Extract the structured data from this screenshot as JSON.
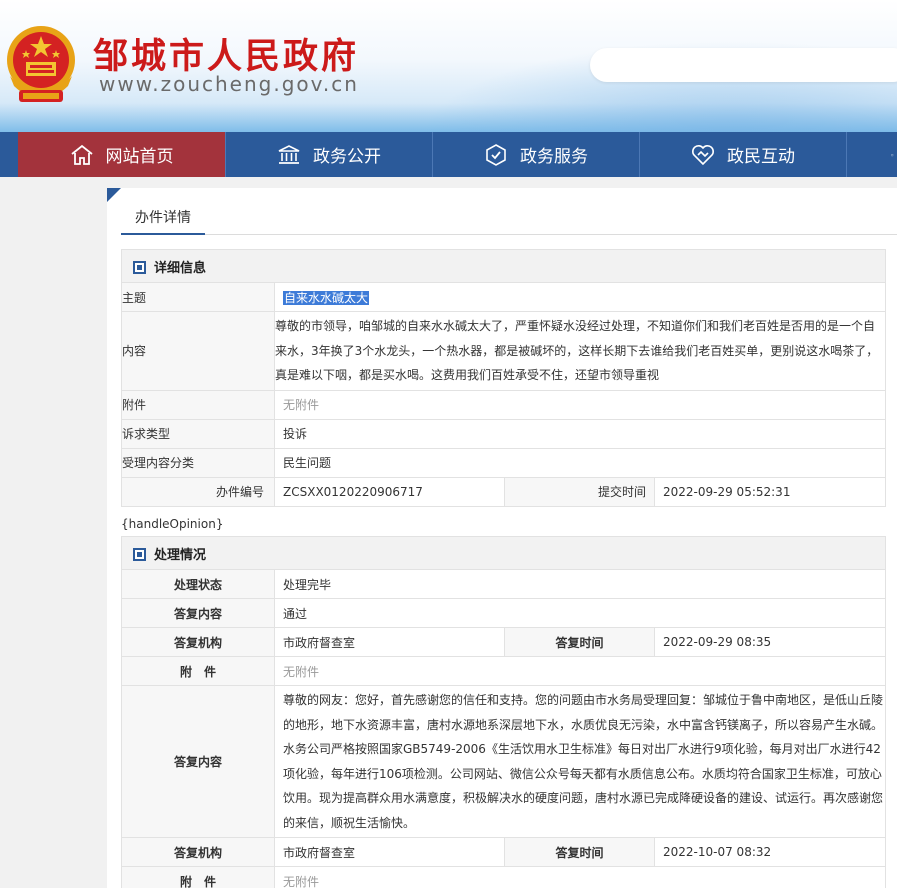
{
  "header": {
    "site_name": "邹城市人民政府",
    "site_url": "www.zoucheng.gov.cn",
    "emblem_icon": "national-emblem-icon"
  },
  "nav": {
    "items": [
      {
        "label": "网站首页",
        "icon": "home-icon"
      },
      {
        "label": "政务公开",
        "icon": "government-building-icon"
      },
      {
        "label": "政务服务",
        "icon": "service-icon"
      },
      {
        "label": "政民互动",
        "icon": "handshake-icon"
      },
      {
        "label": "",
        "icon": "more-icon"
      }
    ],
    "active_color": "#a3333c",
    "bar_color": "#2b5a9a"
  },
  "tab": {
    "label": "办件详情"
  },
  "detail": {
    "section_title": "详细信息",
    "subject_label": "主题",
    "subject_value": "自来水水碱太大",
    "content_label": "内容",
    "content_value": "尊敬的市领导，咱邹城的自来水水碱太大了，严重怀疑水没经过处理，不知道你们和我们老百姓是否用的是一个自来水，3年换了3个水龙头，一个热水器，都是被碱坏的，这样长期下去谁给我们老百姓买单，更别说这水喝茶了，真是难以下咽，都是买水喝。这费用我们百姓承受不住，还望市领导重视",
    "attachment_label": "附件",
    "attachment_value": "无附件",
    "type_label": "诉求类型",
    "type_value": "投诉",
    "category_label": "受理内容分类",
    "category_value": "民生问题",
    "number_label": "办件编号",
    "number_value": "ZCSXX0120220906717",
    "submit_time_label": "提交时间",
    "submit_time_value": "2022-09-29 05:52:31"
  },
  "handle_opinion_placeholder": "{handleOpinion}",
  "processing": {
    "section_title": "处理情况",
    "status_label": "处理状态",
    "status_value": "处理完毕",
    "reply1_label": "答复内容",
    "reply1_value": "通过",
    "org1_label": "答复机构",
    "org1_value": "市政府督查室",
    "time1_label": "答复时间",
    "time1_value": "2022-09-29 08:35",
    "attach1_label": "附　件",
    "attach1_value": "无附件",
    "reply2_label": "答复内容",
    "reply2_value": "尊敬的网友：您好，首先感谢您的信任和支持。您的问题由市水务局受理回复：邹城位于鲁中南地区，是低山丘陵的地形，地下水资源丰富，唐村水源地系深层地下水，水质优良无污染，水中富含钙镁离子，所以容易产生水碱。水务公司严格按照国家GB5749-2006《生活饮用水卫生标准》每日对出厂水进行9项化验，每月对出厂水进行42项化验，每年进行106项检测。公司网站、微信公众号每天都有水质信息公布。水质均符合国家卫生标准，可放心饮用。现为提高群众用水满意度，积极解决水的硬度问题，唐村水源已完成降硬设备的建设、试运行。再次感谢您的来信，顺祝生活愉快。",
    "org2_label": "答复机构",
    "org2_value": "市政府督查室",
    "time2_label": "答复时间",
    "time2_value": "2022-10-07 08:32",
    "attach2_label": "附　件",
    "attach2_value": "无附件"
  }
}
